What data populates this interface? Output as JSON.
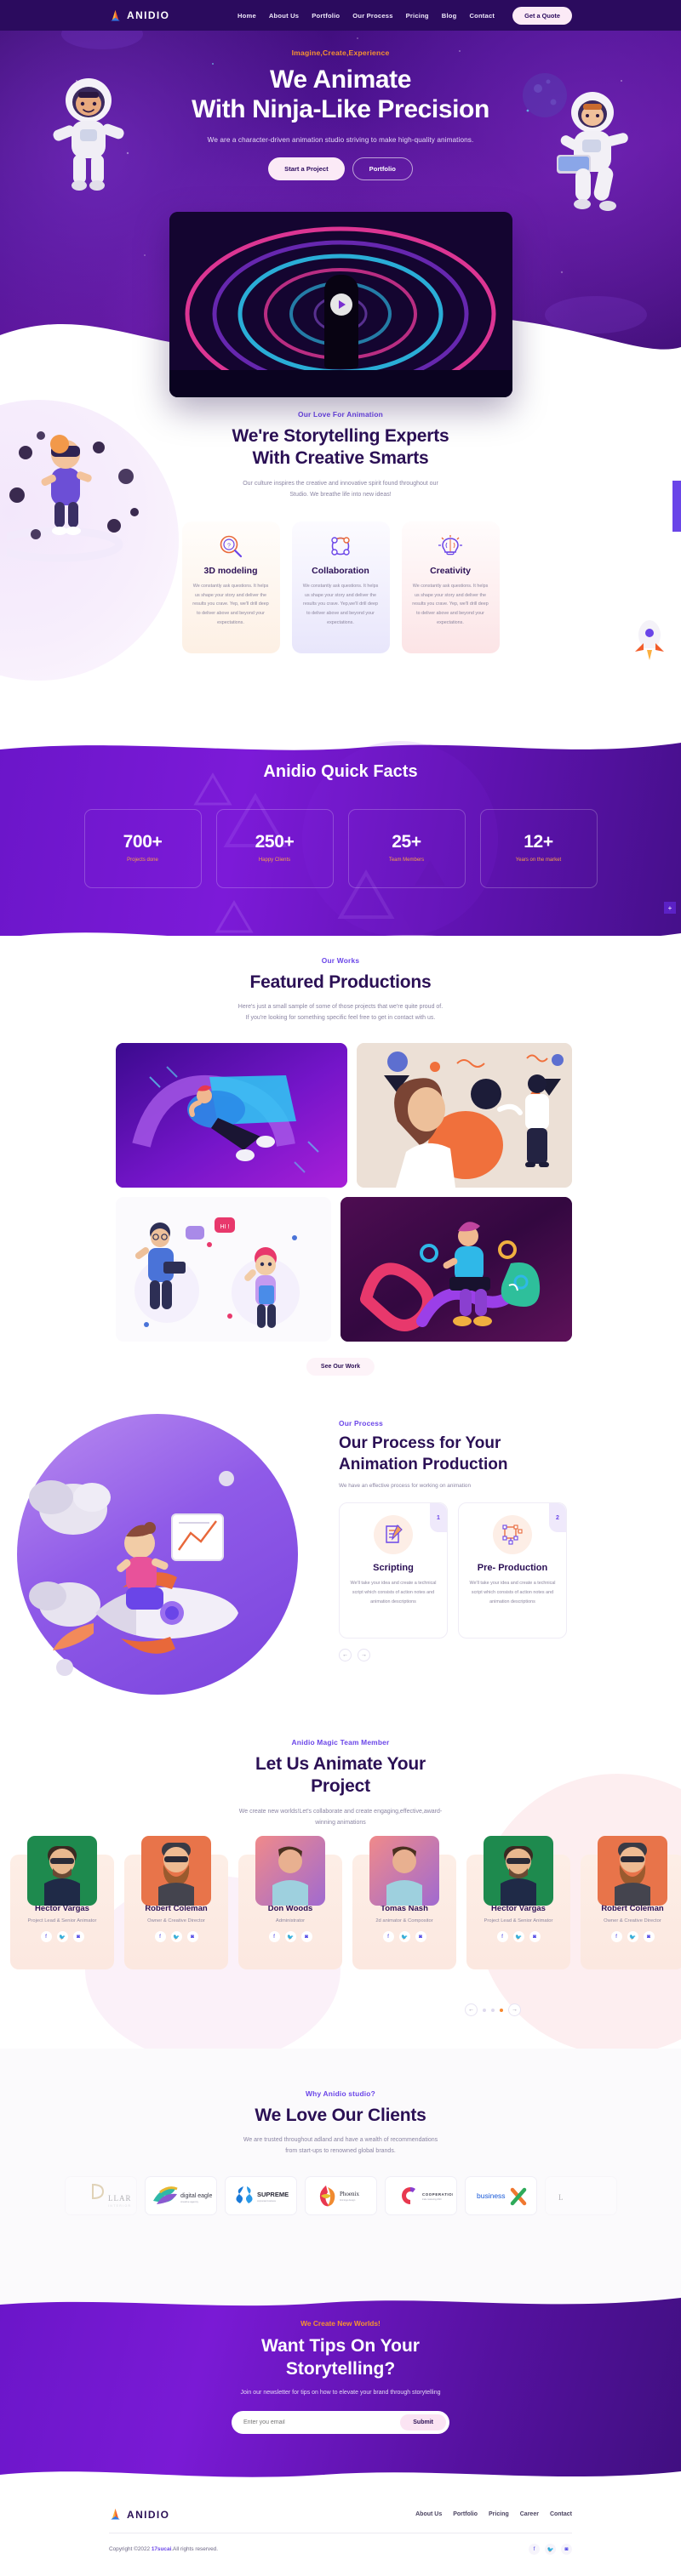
{
  "brand": {
    "name": "ANIDIO"
  },
  "nav": {
    "items": [
      "Home",
      "About Us",
      "Portfolio",
      "Our Process",
      "Pricing",
      "Blog",
      "Contact"
    ],
    "cta": "Get a Quote"
  },
  "hero": {
    "eyebrow": "Imagine,Create,Experience",
    "title_line1": "We Animate",
    "title_line2": "With Ninja-Like Precision",
    "subtitle": "We are a character-driven animation studio striving to make high-quality animations.",
    "btn_primary": "Start a Project",
    "btn_secondary": "Portfolio",
    "play_icon": "play-icon"
  },
  "story": {
    "eyebrow": "Our Love For Animation",
    "title_line1": "We're Storytelling Experts",
    "title_line2": "With Creative Smarts",
    "desc_line1": "Our culture inspires the creative and innovative spirit found throughout our",
    "desc_line2": "Studio. We breathe life into new ideas!",
    "cards": [
      {
        "icon": "magnifier-question-icon",
        "title": "3D modeling",
        "body": "We constantly ask questions. It helps us shape your story and deliver the results you crave. Yep, we'll drill deep to deliver above and beyond your expectations."
      },
      {
        "icon": "nodes-network-icon",
        "title": "Collaboration",
        "body": "We constantly ask questions. It helps us shape your story and deliver the results you crave. Yep,we'll drill deep to deliver above and beyond your expectations."
      },
      {
        "icon": "lightbulb-brain-icon",
        "title": "Creativity",
        "body": "We constantly ask questions. It helps us shape your story and deliver the results you crave. Yep, we'll drill deep to deliver above and beyond your expectations."
      }
    ]
  },
  "facts": {
    "title": "Anidio Quick Facts",
    "items": [
      {
        "value": "700+",
        "label": "Projects done"
      },
      {
        "value": "250+",
        "label": "Happy Clients"
      },
      {
        "value": "25+",
        "label": "Team Members"
      },
      {
        "value": "12+",
        "label": "Years on the market"
      }
    ]
  },
  "works": {
    "eyebrow": "Our Works",
    "title": "Featured Productions",
    "desc_line1": "Here's just a small sample of some of those projects that we're quite proud of.",
    "desc_line2": "If you're looking for something specific feel free to get in contact with us.",
    "cta": "See Our Work",
    "items": [
      {
        "name": "skater-purple-artwork"
      },
      {
        "name": "abstract-people-beige-artwork"
      },
      {
        "name": "teacher-student-artwork"
      },
      {
        "name": "designer-colorful-artwork"
      }
    ]
  },
  "process": {
    "eyebrow": "Our Process",
    "title_line1": "Our Process for Your",
    "title_line2": "Animation Production",
    "desc": "We have an effective process for working on animation",
    "cards": [
      {
        "number": "1",
        "icon": "script-pen-icon",
        "title": "Scripting",
        "body": "We'll take your idea and create a technical script which consists of action notes and animation descriptions"
      },
      {
        "number": "2",
        "icon": "storyboard-nodes-icon",
        "title": "Pre- Production",
        "body": "We'll take your idea and create a technical script which consists of action notes and animation descriptions"
      }
    ],
    "prev_icon": "arrow-left-icon",
    "next_icon": "arrow-right-icon"
  },
  "team": {
    "eyebrow": "Anidio Magic Team Member",
    "title_line1": "Let Us Animate Your",
    "title_line2": "Project",
    "desc_line1": "We create new worlds!Let's collaborate and create engaging,effective,award-",
    "desc_line2": "winning animations",
    "social_icons": [
      "facebook-icon",
      "twitter-icon",
      "instagram-icon"
    ],
    "members": [
      {
        "name": "Hector Vargas",
        "role": "Project Lead & Senior Animator",
        "photo": "green"
      },
      {
        "name": "Robert Coleman",
        "role": "Owner & Creative Director",
        "photo": "orange"
      },
      {
        "name": "Don Woods",
        "role": "Administrator",
        "photo": "pink"
      },
      {
        "name": "Tomas Nash",
        "role": "2d animator & Compositor",
        "photo": "pink"
      },
      {
        "name": "Hector Vargas",
        "role": "Project Lead & Senior Animator",
        "photo": "green"
      },
      {
        "name": "Robert Coleman",
        "role": "Owner & Creative Director",
        "photo": "orange"
      }
    ],
    "dots": 3,
    "active_dot": 3
  },
  "clients": {
    "eyebrow": "Why Anidio studio?",
    "title": "We Love Our Clients",
    "desc_line1": "We are trusted throughout adland and have a wealth of recommendations",
    "desc_line2": "from start-ups to renowned global brands.",
    "logos": [
      "PILLAR",
      "digital eagle",
      "SUPREME",
      "Phoenix",
      "COOPERATION",
      "businessX",
      "L"
    ]
  },
  "newsletter": {
    "eyebrow": "We Create New Worlds!",
    "title_line1": "Want Tips On Your",
    "title_line2": "Storytelling?",
    "desc": "Join our newsletter for tips on how to elevate your brand through storytelling",
    "input_placeholder": "Enter you email",
    "input_value": "",
    "submit": "Submit"
  },
  "footer": {
    "brand": "ANIDIO",
    "links": [
      "About Us",
      "Portfolio",
      "Pricing",
      "Career",
      "Contact"
    ],
    "copyright_pre": "Copyright ©2022 ",
    "copyright_brand": "17sucai",
    "copyright_post": ".All rights reserved.",
    "social_icons": [
      "facebook-icon",
      "twitter-icon",
      "instagram-icon"
    ]
  },
  "widget": {
    "badge": "+"
  },
  "colors": {
    "brand_purple": "#2b0b5e",
    "accent_purple": "#6a45e8",
    "accent_orange": "#f7922f",
    "deep_violet": "#2b1055"
  }
}
